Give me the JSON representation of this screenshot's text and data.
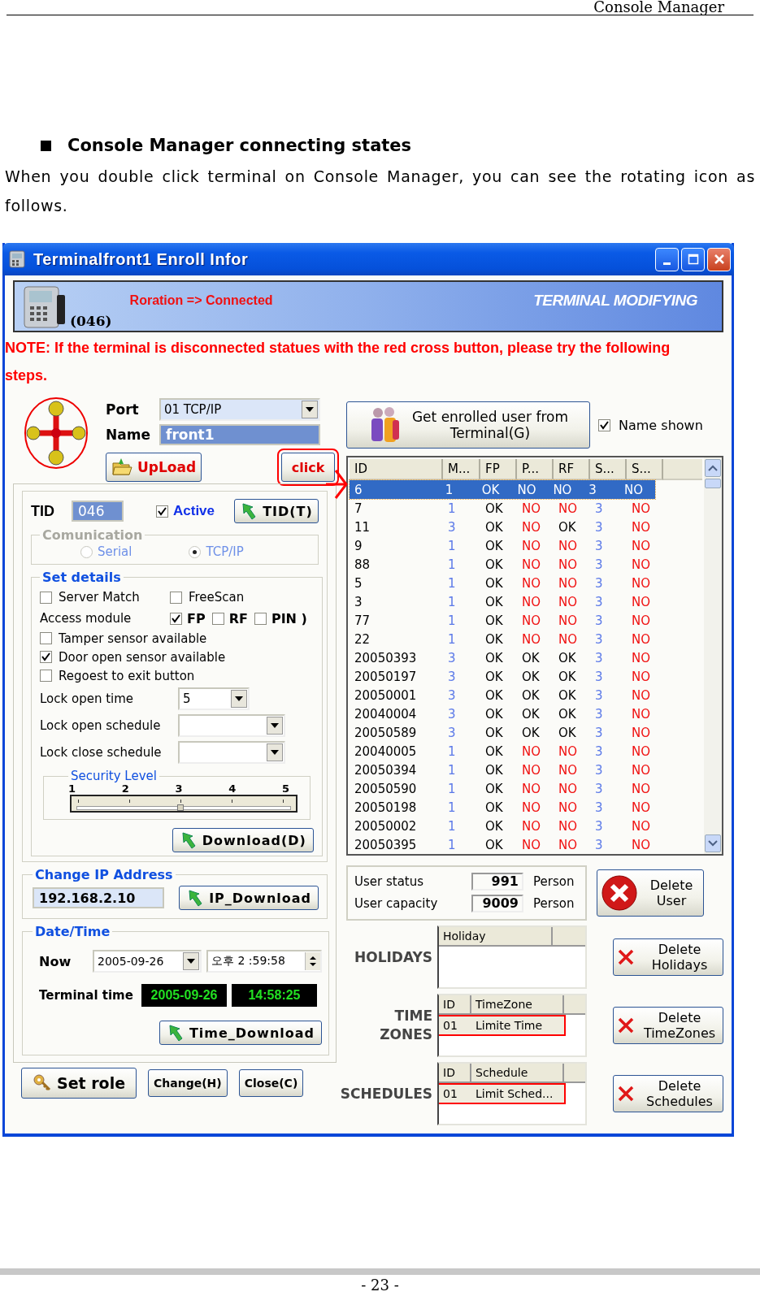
{
  "page_header": "Console Manager",
  "heading": "Console Manager connecting states",
  "paragraph": "When you double click terminal on Console Manager, you can see the rotating icon as follows.",
  "window": {
    "title": "Terminalfront1  Enroll Infor"
  },
  "banner": {
    "tid": "(046)",
    "status": "Roration => Connected",
    "mode": "TERMINAL MODIFYING"
  },
  "note": "NOTE: If the terminal is disconnected statues with the red cross button, please try the following steps.",
  "port": {
    "label": "Port",
    "value": "01 TCP/IP"
  },
  "name": {
    "label": "Name",
    "value": "front1"
  },
  "upload_button": "UpLoad",
  "click_button": "click",
  "tid": {
    "label": "TID",
    "value": "046",
    "active_label": "Active",
    "active_checked": true,
    "button": "TID(T)"
  },
  "communication": {
    "title": "Comunication",
    "options": [
      {
        "label": "Serial",
        "selected": false
      },
      {
        "label": "TCP/IP",
        "selected": true
      }
    ]
  },
  "set_details": {
    "title": "Set details",
    "options": [
      {
        "label": "Server Match",
        "checked": false
      },
      {
        "label": "FreeScan",
        "checked": false
      }
    ],
    "access_module": {
      "label": "Access module",
      "options": [
        {
          "label": "FP",
          "checked": true
        },
        {
          "label": "RF",
          "checked": false
        },
        {
          "label": "PIN )",
          "checked": false
        }
      ]
    },
    "sensors": [
      {
        "label": "Tamper sensor available",
        "checked": false
      },
      {
        "label": "Door open sensor available",
        "checked": true
      },
      {
        "label": "Regoest to exit button",
        "checked": false
      }
    ],
    "lock_open_time": {
      "label": "Lock open time",
      "value": "5"
    },
    "lock_open_schedule": {
      "label": "Lock open schedule"
    },
    "lock_close_schedule": {
      "label": "Lock close schedule"
    },
    "security_level": {
      "title": "Security Level",
      "ticks": [
        "1",
        "2",
        "3",
        "4",
        "5"
      ],
      "level": 0.5
    },
    "download_button": "Download(D)"
  },
  "change_ip": {
    "title": "Change IP Address",
    "value": "192.168.2.10",
    "button": "IP_Download"
  },
  "date_time": {
    "title": "Date/Time",
    "now_label": "Now",
    "date": "2005-09-26",
    "time": "오후 2 :59:58",
    "terminal_label": "Terminal time",
    "terminal_date": "2005-09-26",
    "terminal_time": "14:58:25",
    "button": "Time_Download"
  },
  "set_role_button": "Set role",
  "buttons": [
    "Change(H)",
    "Close(C)"
  ],
  "get_users_button": {
    "lines": [
      "Get enrolled user from",
      "Terminal(G)"
    ]
  },
  "name_shown": {
    "label": "Name shown",
    "checked": true
  },
  "users_table": {
    "columns": [
      {
        "label": "ID",
        "kind": "text"
      },
      {
        "label": "M...",
        "kind": "count"
      },
      {
        "label": "FP",
        "kind": "flag"
      },
      {
        "label": "P...",
        "kind": "flag"
      },
      {
        "label": "RF",
        "kind": "flag"
      },
      {
        "label": "S...",
        "kind": "count"
      },
      {
        "label": "S...",
        "kind": "flag"
      }
    ],
    "rows": [
      {
        "selected": true,
        "cells": [
          "6",
          "1",
          "OK",
          "NO",
          "NO",
          "3",
          "NO"
        ]
      },
      {
        "selected": false,
        "cells": [
          "7",
          "1",
          "OK",
          "NO",
          "NO",
          "3",
          "NO"
        ],
        "ok": [
          true,
          false,
          false,
          false
        ]
      },
      {
        "selected": false,
        "cells": [
          "11",
          "3",
          "OK",
          "NO",
          "OK",
          "3",
          "NO"
        ],
        "ok": [
          true,
          false,
          true,
          false
        ]
      },
      {
        "selected": false,
        "cells": [
          "9",
          "1",
          "OK",
          "NO",
          "NO",
          "3",
          "NO"
        ],
        "ok": [
          true,
          false,
          false,
          false
        ]
      },
      {
        "selected": false,
        "cells": [
          "88",
          "1",
          "OK",
          "NO",
          "NO",
          "3",
          "NO"
        ],
        "ok": [
          true,
          false,
          false,
          false
        ]
      },
      {
        "selected": false,
        "cells": [
          "5",
          "1",
          "OK",
          "NO",
          "NO",
          "3",
          "NO"
        ],
        "ok": [
          true,
          false,
          false,
          false
        ]
      },
      {
        "selected": false,
        "cells": [
          "3",
          "1",
          "OK",
          "NO",
          "NO",
          "3",
          "NO"
        ],
        "ok": [
          true,
          false,
          false,
          false
        ]
      },
      {
        "selected": false,
        "cells": [
          "77",
          "1",
          "OK",
          "NO",
          "NO",
          "3",
          "NO"
        ],
        "ok": [
          true,
          false,
          false,
          false
        ]
      },
      {
        "selected": false,
        "cells": [
          "22",
          "1",
          "OK",
          "NO",
          "NO",
          "3",
          "NO"
        ],
        "ok": [
          true,
          false,
          false,
          false
        ]
      },
      {
        "selected": false,
        "cells": [
          "20050393",
          "3",
          "OK",
          "OK",
          "OK",
          "3",
          "NO"
        ],
        "ok": [
          true,
          true,
          true,
          false
        ]
      },
      {
        "selected": false,
        "cells": [
          "20050197",
          "3",
          "OK",
          "OK",
          "OK",
          "3",
          "NO"
        ],
        "ok": [
          true,
          true,
          true,
          false
        ]
      },
      {
        "selected": false,
        "cells": [
          "20050001",
          "3",
          "OK",
          "OK",
          "OK",
          "3",
          "NO"
        ],
        "ok": [
          true,
          true,
          true,
          false
        ]
      },
      {
        "selected": false,
        "cells": [
          "20040004",
          "3",
          "OK",
          "OK",
          "OK",
          "3",
          "NO"
        ],
        "ok": [
          true,
          true,
          true,
          false
        ]
      },
      {
        "selected": false,
        "cells": [
          "20050589",
          "3",
          "OK",
          "OK",
          "OK",
          "3",
          "NO"
        ],
        "ok": [
          true,
          true,
          true,
          false
        ]
      },
      {
        "selected": false,
        "cells": [
          "20040005",
          "1",
          "OK",
          "NO",
          "NO",
          "3",
          "NO"
        ],
        "ok": [
          true,
          false,
          false,
          false
        ]
      },
      {
        "selected": false,
        "cells": [
          "20050394",
          "1",
          "OK",
          "NO",
          "NO",
          "3",
          "NO"
        ],
        "ok": [
          true,
          false,
          false,
          false
        ]
      },
      {
        "selected": false,
        "cells": [
          "20050590",
          "1",
          "OK",
          "NO",
          "NO",
          "3",
          "NO"
        ],
        "ok": [
          true,
          false,
          false,
          false
        ]
      },
      {
        "selected": false,
        "cells": [
          "20050198",
          "1",
          "OK",
          "NO",
          "NO",
          "3",
          "NO"
        ],
        "ok": [
          true,
          false,
          false,
          false
        ]
      },
      {
        "selected": false,
        "cells": [
          "20050002",
          "1",
          "OK",
          "NO",
          "NO",
          "3",
          "NO"
        ],
        "ok": [
          true,
          false,
          false,
          false
        ]
      },
      {
        "selected": false,
        "cells": [
          "20050395",
          "1",
          "OK",
          "NO",
          "NO",
          "3",
          "NO"
        ],
        "ok": [
          true,
          false,
          false,
          false
        ]
      }
    ]
  },
  "user_status": [
    {
      "label": "User status",
      "value": "991",
      "unit": "Person"
    },
    {
      "label": "User capacity",
      "value": "9009",
      "unit": "Person"
    }
  ],
  "delete_user_button": {
    "lines": [
      "Delete",
      "User"
    ]
  },
  "lists": [
    {
      "title": [
        "HOLIDAYS"
      ],
      "columns": [
        "Holiday"
      ],
      "delete_button": [
        "Delete",
        "Holidays"
      ]
    },
    {
      "title": [
        "TIME",
        "ZONES"
      ],
      "columns": [
        "ID",
        "TimeZone"
      ],
      "rows": [
        {
          "cells": [
            "01",
            "Limite Time"
          ],
          "highlighted": true
        }
      ],
      "delete_button": [
        "Delete",
        "TimeZones"
      ]
    },
    {
      "title": [
        "SCHEDULES"
      ],
      "columns": [
        "ID",
        "Schedule"
      ],
      "rows": [
        {
          "cells": [
            "01",
            "Limit Sched..."
          ],
          "highlighted": true
        }
      ],
      "delete_button": [
        "Delete",
        "Schedules"
      ]
    }
  ],
  "footer": "- 23 -"
}
